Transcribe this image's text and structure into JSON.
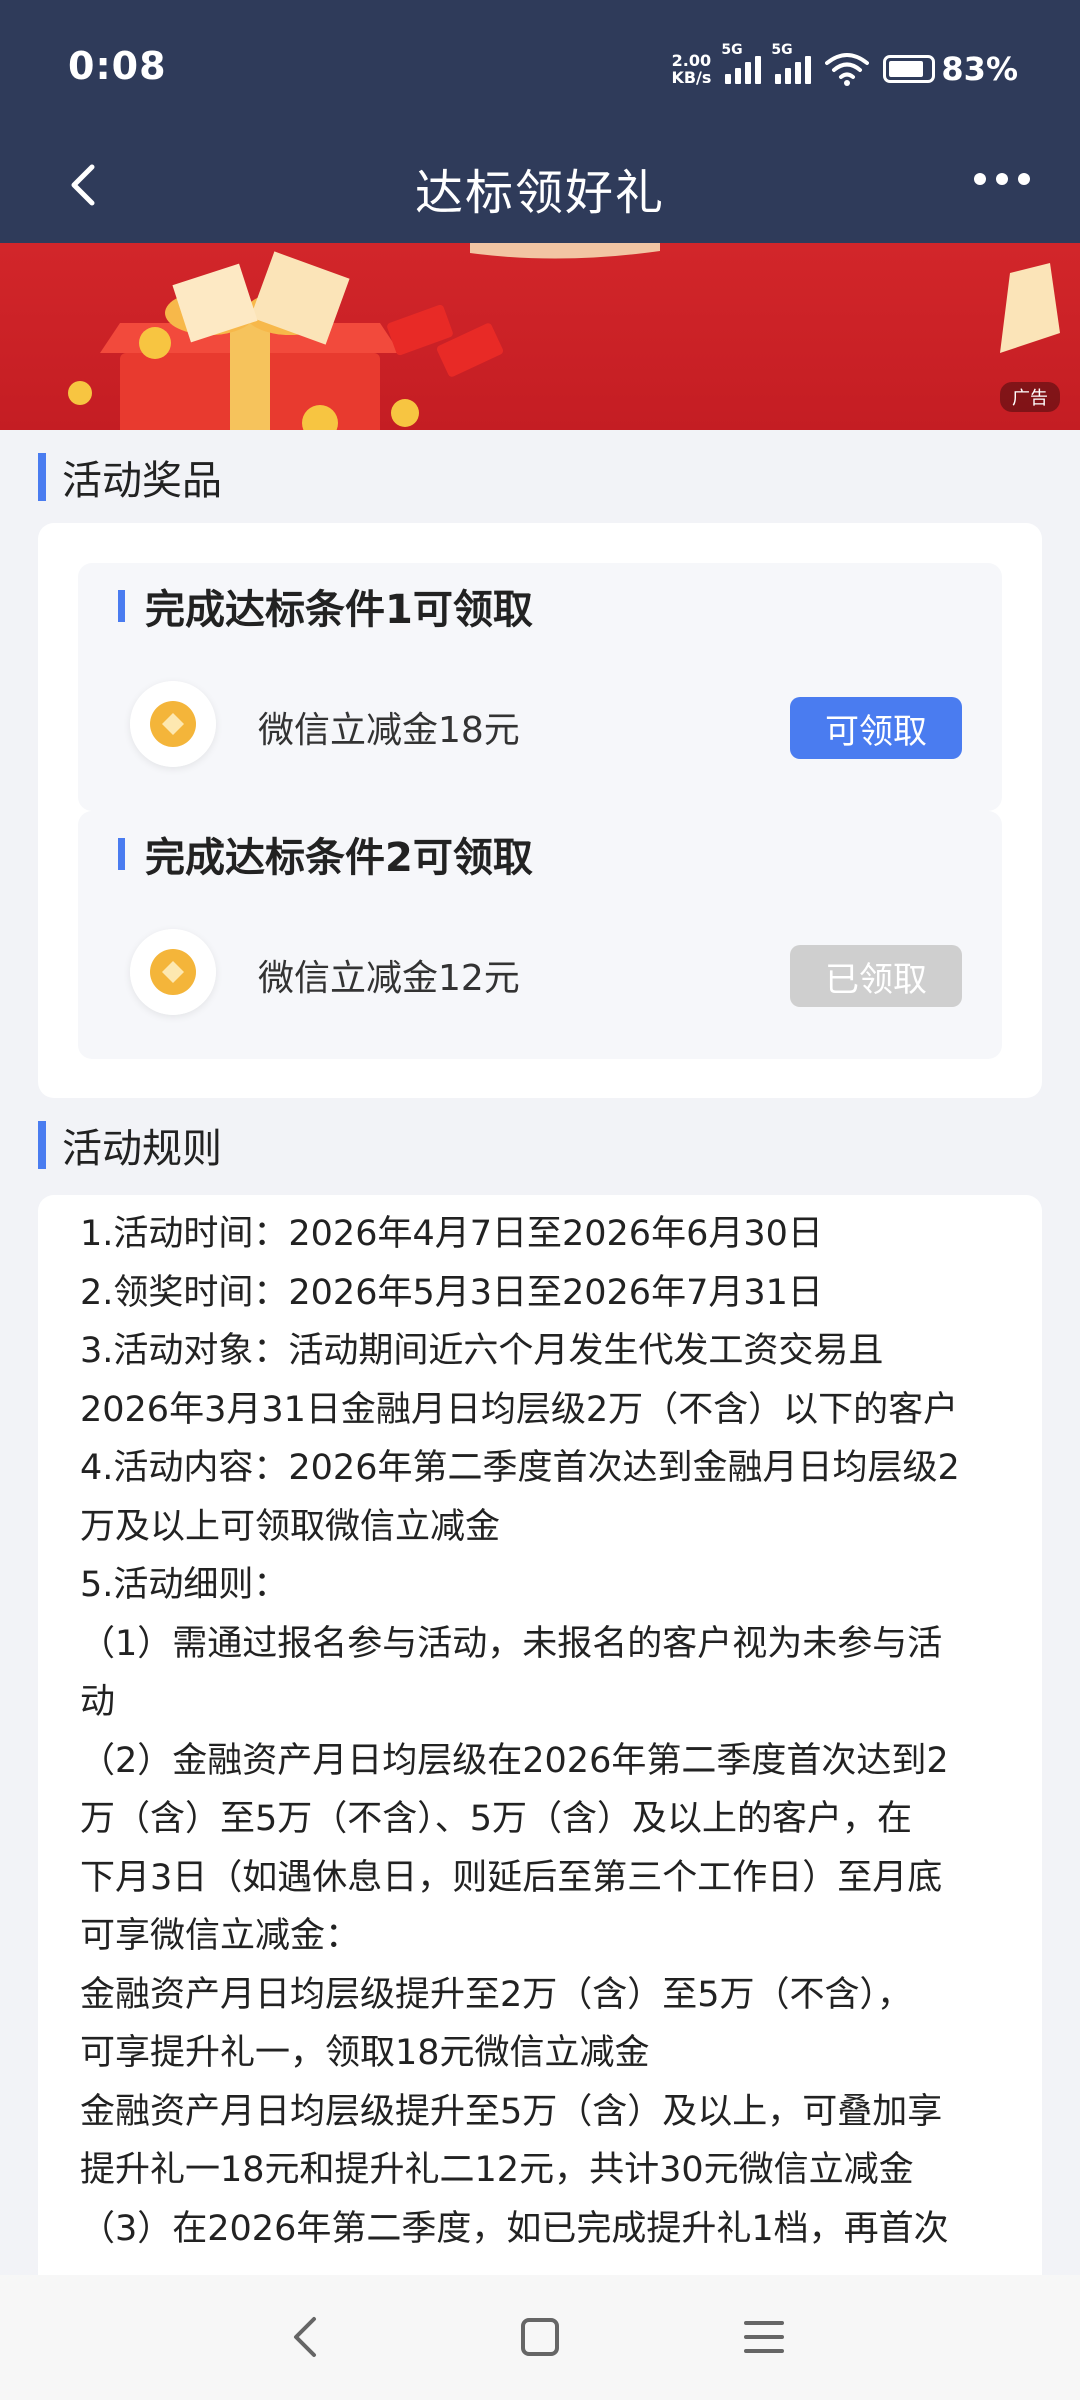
{
  "status_bar": {
    "time": "0:08",
    "net_speed_value": "2.00",
    "net_speed_unit": "KB/s",
    "signal1_label": "5G",
    "signal2_label": "5G",
    "battery_percent": "83%",
    "battery_level": 0.83
  },
  "header": {
    "title": "达标领好礼",
    "back_icon": "chevron-left-icon",
    "more_icon": "more-dots-icon"
  },
  "banner": {
    "ad_label": "广告"
  },
  "prizes": {
    "section_title": "活动奖品",
    "items": [
      {
        "condition": "完成达标条件1可领取",
        "name": "微信立减金18元",
        "button": "可领取",
        "state": "active"
      },
      {
        "condition": "完成达标条件2可领取",
        "name": "微信立减金12元",
        "button": "已领取",
        "state": "done"
      }
    ]
  },
  "rules": {
    "section_title": "活动规则",
    "lines": [
      "1.活动时间：2026年4月7日至2026年6月30日",
      "2.领奖时间：2026年5月3日至2026年7月31日",
      "3.活动对象：活动期间近六个月发生代发工资交易且",
      "2026年3月31日金融月日均层级2万（不含）以下的客户",
      "4.活动内容：2026年第二季度首次达到金融月日均层级2",
      "万及以上可领取微信立减金",
      "5.活动细则：",
      "（1）需通过报名参与活动，未报名的客户视为未参与活",
      "动",
      "（2）金融资产月日均层级在2026年第二季度首次达到2",
      "万（含）至5万（不含）、5万（含）及以上的客户，在",
      "下月3日（如遇休息日，则延后至第三个工作日）至月底",
      "可享微信立减金：",
      "金融资产月日均层级提升至2万（含）至5万（不含），",
      "可享提升礼一，领取18元微信立减金",
      "金融资产月日均层级提升至5万（含）及以上，可叠加享",
      "提升礼一18元和提升礼二12元，共计30元微信立减金",
      "（3）在2026年第二季度，如已完成提升礼1档，再首次"
    ]
  },
  "colors": {
    "header_bg": "#2f3b5a",
    "accent": "#4a7cf0",
    "banner_red": "#c41d23",
    "disabled": "#cfcfcf"
  }
}
